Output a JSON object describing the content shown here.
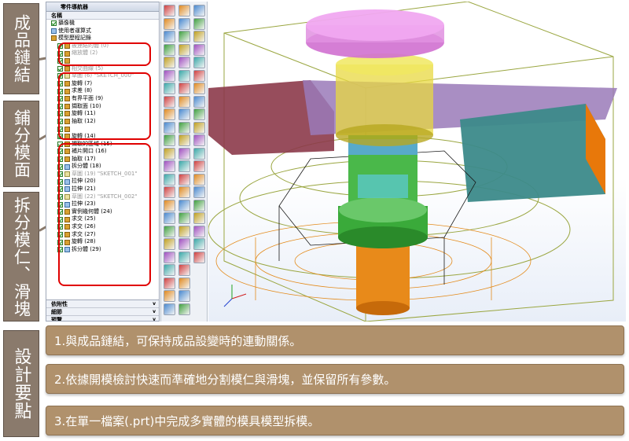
{
  "labels": {
    "product_link": "成品鏈結",
    "split_surface": "鋪分模面",
    "split_cores": "拆分模仁、滑塊",
    "design_points": "設計要點"
  },
  "navigator": {
    "title": "零件導航器",
    "column_header": "名稱",
    "top_items": [
      "攝像機",
      "使用者運算式",
      "模型歷程記錄"
    ],
    "features": [
      {
        "label": "被連結的體 (0)",
        "icon": "linked-body-icon",
        "grey": true
      },
      {
        "label": "縮放體 (2)",
        "icon": "scale-body-icon",
        "grey": true
      },
      {
        "label": "",
        "icon": "feature-icon",
        "grey": false
      },
      {
        "label": "相交曲線 (5)",
        "icon": "curve-icon",
        "grey": true
      },
      {
        "label": "草圖 (6) \"SKETCH_000\"",
        "icon": "sketch-icon",
        "grey": true
      },
      {
        "label": "旋轉 (7)",
        "icon": "revolve-icon",
        "grey": false
      },
      {
        "label": "求差 (8)",
        "icon": "subtract-icon",
        "grey": false
      },
      {
        "label": "有界平面 (9)",
        "icon": "plane-icon",
        "grey": false
      },
      {
        "label": "擷取面 (10)",
        "icon": "extract-icon",
        "grey": false
      },
      {
        "label": "旋轉 (11)",
        "icon": "revolve-icon",
        "grey": false
      },
      {
        "label": "抽取 (12)",
        "icon": "extract-icon",
        "grey": false
      },
      {
        "label": "",
        "icon": "feature-icon",
        "grey": false
      },
      {
        "label": "旋轉 (14)",
        "icon": "revolve-icon",
        "grey": false
      },
      {
        "label": "擷取的區域 (15)",
        "icon": "region-icon",
        "grey": false
      },
      {
        "label": "補片開口 (16)",
        "icon": "patch-icon",
        "grey": false
      },
      {
        "label": "抽取 (17)",
        "icon": "extract-icon",
        "grey": false
      },
      {
        "label": "拆分體 (18)",
        "icon": "split-icon",
        "grey": false
      },
      {
        "label": "草圖 (19) \"SKETCH_001\"",
        "icon": "sketch-icon",
        "grey": true
      },
      {
        "label": "拉伸 (20)",
        "icon": "extrude-icon",
        "grey": false
      },
      {
        "label": "拉伸 (21)",
        "icon": "extrude-icon",
        "grey": false
      },
      {
        "label": "草圖 (22) \"SKETCH_002\"",
        "icon": "sketch-icon",
        "grey": true
      },
      {
        "label": "拉伸 (23)",
        "icon": "extrude-icon",
        "grey": false
      },
      {
        "label": "實例幾何體 (24)",
        "icon": "instance-icon",
        "grey": false
      },
      {
        "label": "求交 (25)",
        "icon": "intersect-icon",
        "grey": false
      },
      {
        "label": "求交 (26)",
        "icon": "intersect-icon",
        "grey": false
      },
      {
        "label": "求交 (27)",
        "icon": "intersect-icon",
        "grey": false
      },
      {
        "label": "旋轉 (28)",
        "icon": "revolve-icon",
        "grey": false
      },
      {
        "label": "拆分體 (29)",
        "icon": "split-icon",
        "grey": false
      }
    ],
    "bottom_sections": [
      "依附性",
      "細節",
      "預覽"
    ]
  },
  "points": [
    "1.與成品鏈結，可保持成品設變時的連動關係。",
    "2.依據開模檢討快速而準確地分割模仁與滑塊，並保留所有參數。",
    "3.在單一檔案(.prt)中完成多實體的模具模型拆模。"
  ],
  "colors": {
    "label_bg": "#8a7a6c",
    "point_bg": "#b0916c",
    "highlight_border": "#e00000"
  }
}
